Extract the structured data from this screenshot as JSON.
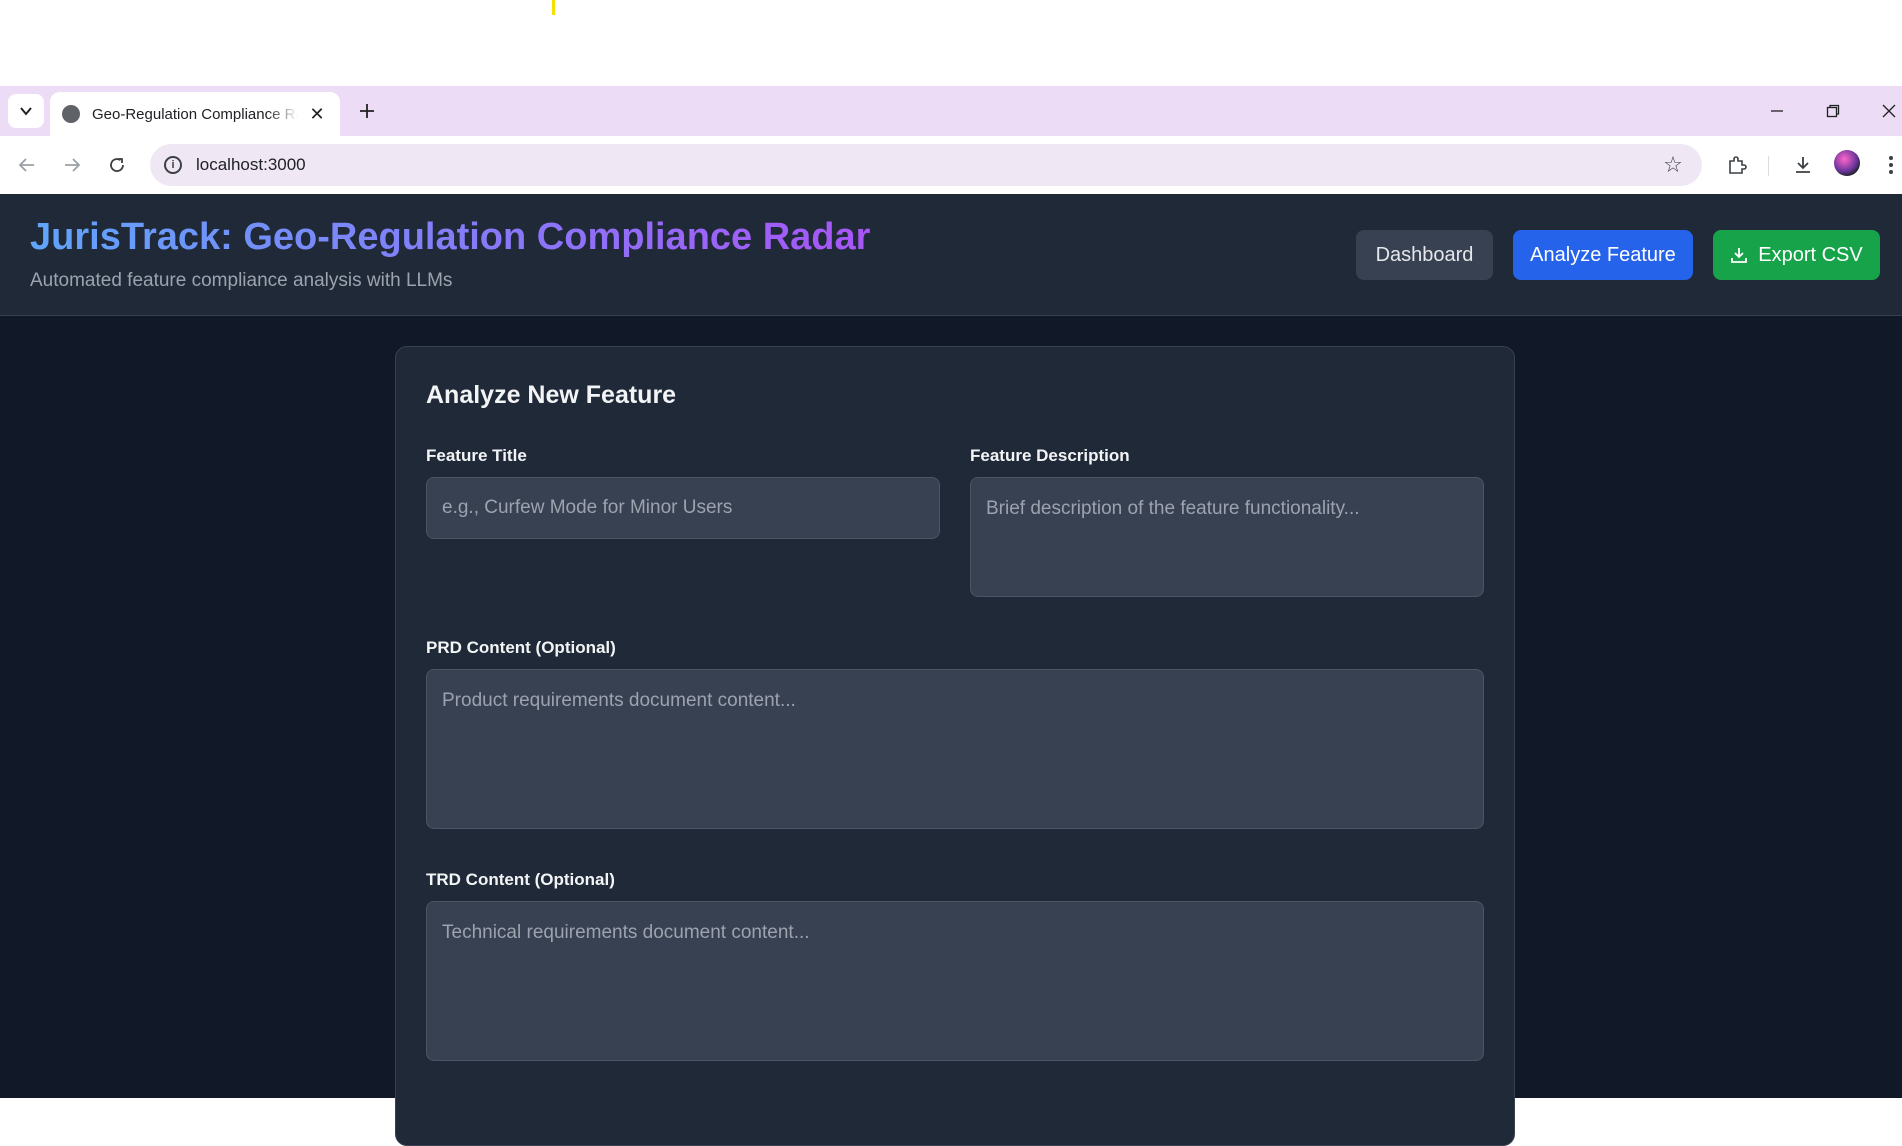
{
  "browser": {
    "tab_title": "Geo-Regulation Compliance Radar",
    "url": "localhost:3000"
  },
  "header": {
    "title": "JurisTrack: Geo-Regulation Compliance Radar",
    "subtitle": "Automated feature compliance analysis with LLMs",
    "buttons": {
      "dashboard": "Dashboard",
      "analyze": "Analyze Feature",
      "export": "Export CSV"
    }
  },
  "form": {
    "title": "Analyze New Feature",
    "feature_title": {
      "label": "Feature Title",
      "placeholder": "e.g., Curfew Mode for Minor Users"
    },
    "feature_description": {
      "label": "Feature Description",
      "placeholder": "Brief description of the feature functionality..."
    },
    "prd": {
      "label": "PRD Content (Optional)",
      "placeholder": "Product requirements document content..."
    },
    "trd": {
      "label": "TRD Content (Optional)",
      "placeholder": "Technical requirements document content..."
    }
  },
  "colors": {
    "app_bg": "#111827",
    "card_bg": "#1f2937",
    "accent_blue": "#2563eb",
    "accent_green": "#16a34a",
    "title_gradient_start": "#60a5fa",
    "title_gradient_end": "#a855f7"
  }
}
